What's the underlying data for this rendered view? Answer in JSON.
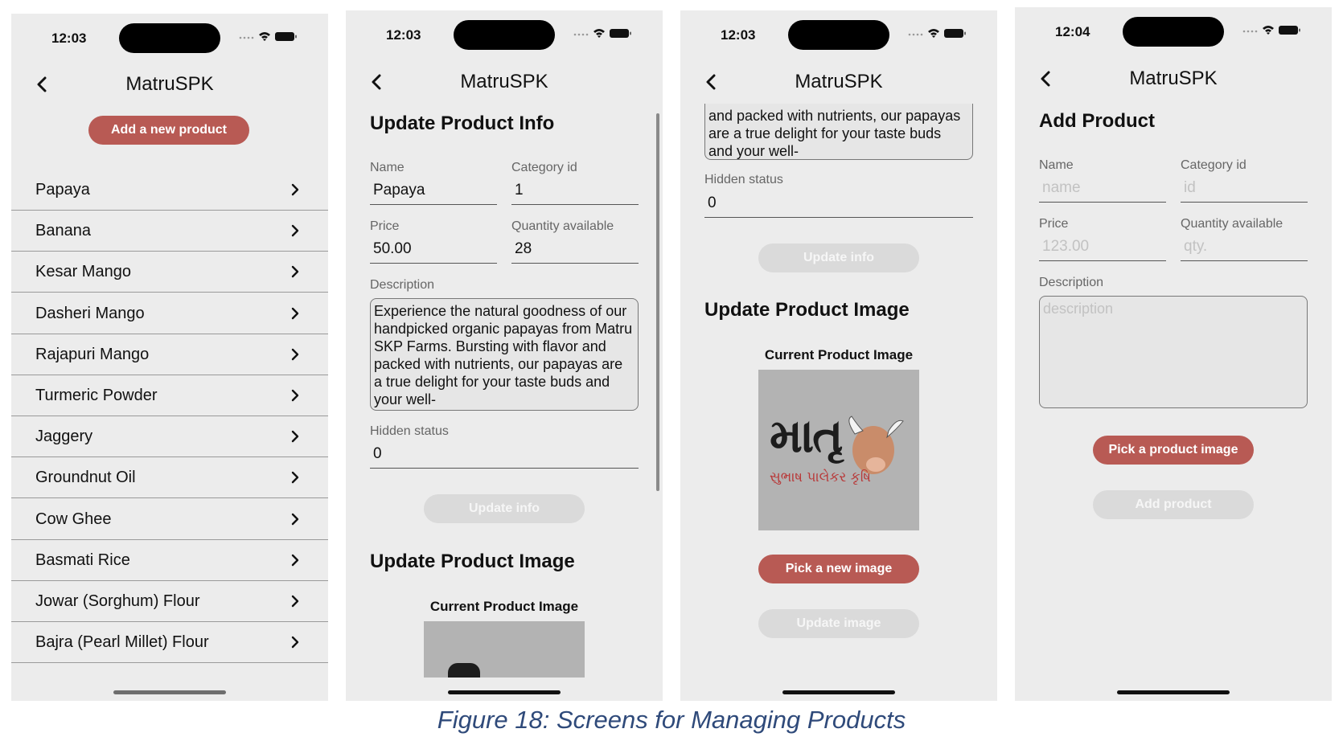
{
  "app_title": "MatruSPK",
  "screens": {
    "list": {
      "time": "12:03",
      "add_button": "Add a new product",
      "items": [
        "Papaya",
        "Banana",
        "Kesar Mango",
        "Dasheri Mango",
        "Rajapuri Mango",
        "Turmeric Powder",
        "Jaggery",
        "Groundnut Oil",
        "Cow Ghee",
        "Basmati Rice",
        "Jowar (Sorghum) Flour",
        "Bajra (Pearl Millet) Flour"
      ]
    },
    "update": {
      "time": "12:03",
      "heading": "Update Product Info",
      "name_label": "Name",
      "name_value": "Papaya",
      "category_label": "Category id",
      "category_value": "1",
      "price_label": "Price",
      "price_value": "50.00",
      "qty_label": "Quantity available",
      "qty_value": "28",
      "desc_label": "Description",
      "desc_value": "Experience the natural goodness of our handpicked organic papayas from Matru SKP Farms. Bursting with flavor and packed with nutrients, our papayas are a true delight for your taste buds and your well-",
      "hidden_label": "Hidden status",
      "hidden_value": "0",
      "update_info_button": "Update info",
      "image_heading": "Update Product Image",
      "current_image_caption": "Current Product Image"
    },
    "update_scrolled": {
      "time": "12:03",
      "desc_tail": "and packed with nutrients, our papayas are a true delight for your taste buds and your well-",
      "hidden_label": "Hidden status",
      "hidden_value": "0",
      "update_info_button": "Update info",
      "image_heading": "Update Product Image",
      "current_image_caption": "Current Product Image",
      "logo_main": "માતૃ",
      "logo_sub": "સુભાષ પાલેકર કૃષિ",
      "pick_image_button": "Pick a new image",
      "update_image_button": "Update image"
    },
    "add": {
      "time": "12:04",
      "heading": "Add Product",
      "name_label": "Name",
      "name_placeholder": "name",
      "category_label": "Category id",
      "category_placeholder": "id",
      "price_label": "Price",
      "price_placeholder": "123.00",
      "qty_label": "Quantity available",
      "qty_placeholder": "qty.",
      "desc_label": "Description",
      "desc_placeholder": "description",
      "pick_image_button": "Pick a product image",
      "add_button": "Add product"
    }
  },
  "figure_caption": "Figure 18: Screens for Managing Products",
  "colors": {
    "accent": "#b85a54",
    "disabled": "#dadada",
    "screen_bg": "#ececec",
    "caption": "#2f4a7a"
  }
}
